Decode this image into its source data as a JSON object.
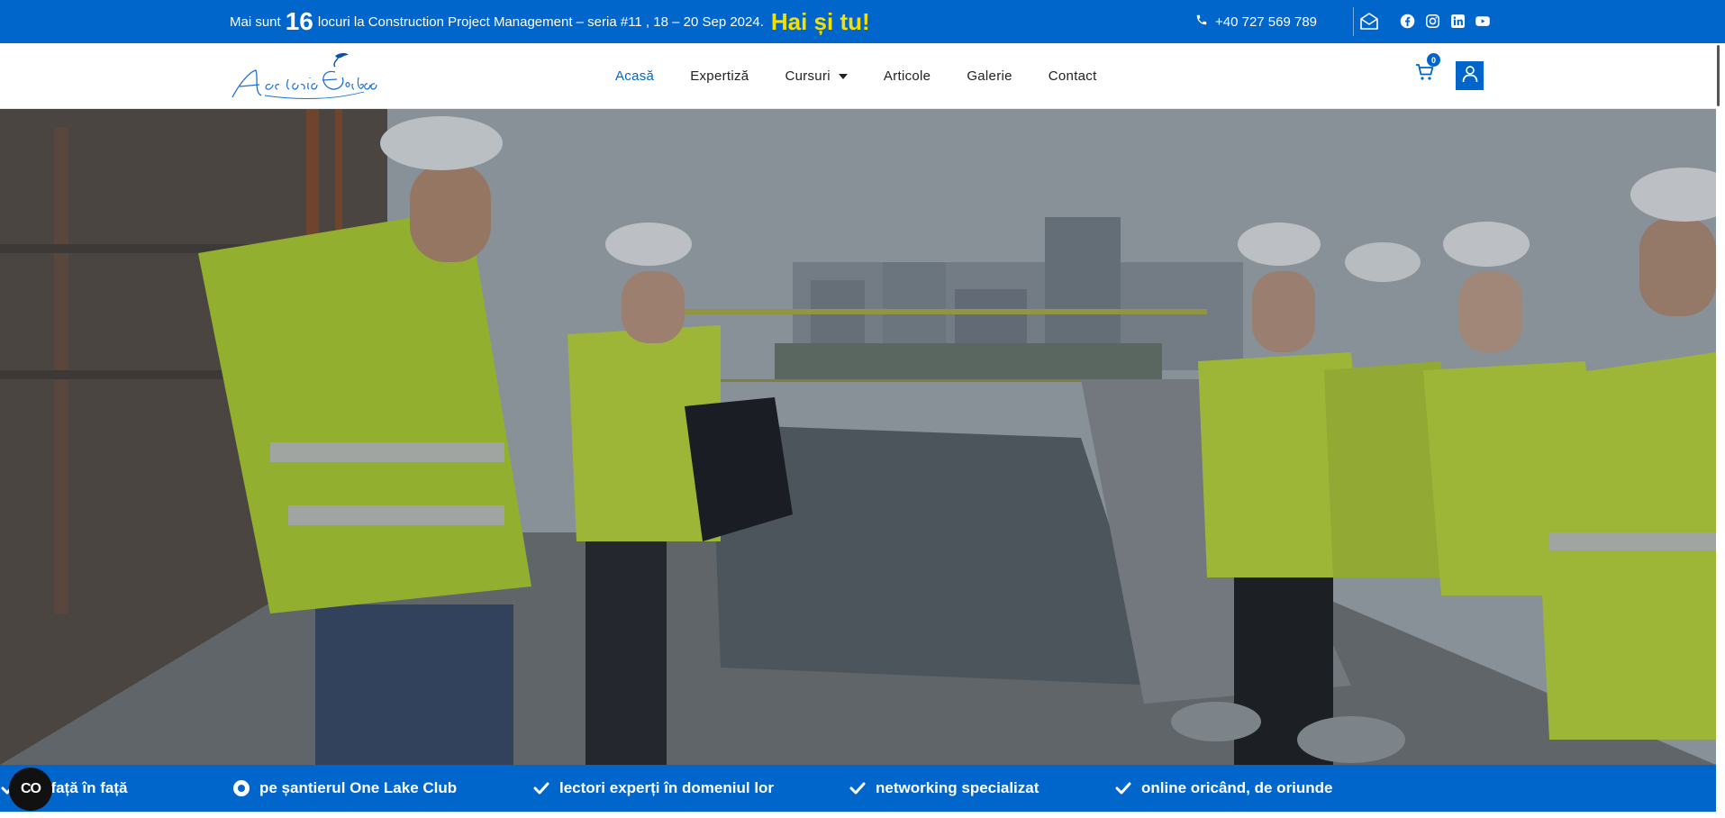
{
  "topbar": {
    "promo_prefix": "Mai sunt",
    "promo_count": "16",
    "promo_text": "locuri la Construction Project Management – seria #11 , 18 – 20 Sep 2024.",
    "promo_cta": "Hai și tu!",
    "phone": "+40 727 569 789",
    "socials": [
      "facebook-icon",
      "instagram-icon",
      "linkedin-icon",
      "youtube-icon"
    ]
  },
  "header": {
    "logo_text": "Academia Eerobea",
    "nav": [
      {
        "label": "Acasă",
        "active": true
      },
      {
        "label": "Expertiză",
        "active": false
      },
      {
        "label": "Cursuri",
        "active": false,
        "dropdown": true
      },
      {
        "label": "Articole",
        "active": false
      },
      {
        "label": "Galerie",
        "active": false
      },
      {
        "label": "Contact",
        "active": false
      }
    ],
    "cart_count": "0"
  },
  "marquee": {
    "items": [
      {
        "icon": "check-icon",
        "text": "uri față în față"
      },
      {
        "icon": "radio-icon",
        "text": "pe șantierul One Lake Club"
      },
      {
        "icon": "check-icon",
        "text": "lectori experți în domeniul lor"
      },
      {
        "icon": "check-icon",
        "text": "networking specializat"
      },
      {
        "icon": "check-icon",
        "text": "online oricând, de oriunde"
      }
    ]
  },
  "accessibility_button": "CO",
  "colors": {
    "brand_blue": "#0066CC",
    "cta_yellow": "#F5E000"
  }
}
